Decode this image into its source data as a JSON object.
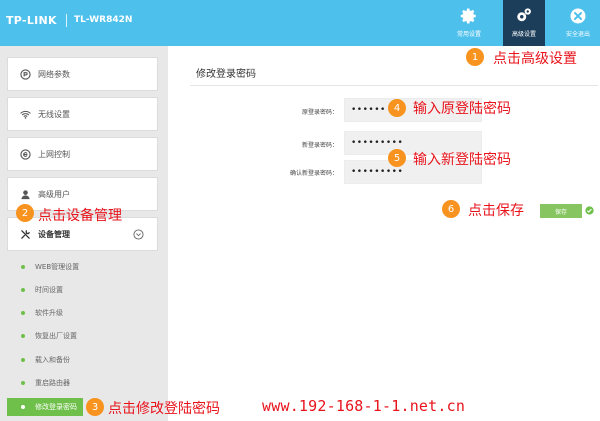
{
  "header": {
    "brand": "TP-LINK",
    "model": "TL-WR842N",
    "buttons": [
      {
        "label": "常用设置",
        "icon": "gear-icon",
        "active": false
      },
      {
        "label": "高级设置",
        "icon": "gears-icon",
        "active": true
      },
      {
        "label": "安全退出",
        "icon": "close-circle-icon",
        "active": false
      }
    ],
    "colors": {
      "header_bg": "#4ec0ec",
      "active_btn_bg": "#1d3e5a",
      "accent_green": "#6fc04a",
      "annotation_orange": "#f7931e",
      "annotation_red": "#e8131b"
    }
  },
  "sidebar": {
    "items": [
      {
        "label": "网络参数",
        "icon": "network-icon"
      },
      {
        "label": "无线设置",
        "icon": "wifi-icon"
      },
      {
        "label": "上网控制",
        "icon": "internet-control-icon"
      },
      {
        "label": "高级用户",
        "icon": "user-icon"
      },
      {
        "label": "设备管理",
        "icon": "tools-icon"
      }
    ],
    "sub_items": [
      {
        "label": "WEB管理设置"
      },
      {
        "label": "时间设置"
      },
      {
        "label": "软件升级"
      },
      {
        "label": "恢复出厂设置"
      },
      {
        "label": "载入和备份"
      },
      {
        "label": "重启路由器"
      },
      {
        "label": "修改登录密码",
        "active": true
      }
    ]
  },
  "main": {
    "title": "修改登录密码",
    "fields": [
      {
        "label": "原登录密码：",
        "value": "••••••"
      },
      {
        "label": "新登录密码：",
        "value": "•••••••••"
      },
      {
        "label": "确认新登录密码：",
        "value": "•••••••••"
      }
    ],
    "save_label": "保存"
  },
  "annotations": [
    {
      "num": "1",
      "text": "点击高级设置"
    },
    {
      "num": "2",
      "text": "点击设备管理"
    },
    {
      "num": "3",
      "text": "点击修改登陆密码"
    },
    {
      "num": "4",
      "text": "输入原登陆密码"
    },
    {
      "num": "5",
      "text": "输入新登陆密码"
    },
    {
      "num": "6",
      "text": "点击保存"
    }
  ],
  "watermark": "www.192-168-1-1.net.cn"
}
